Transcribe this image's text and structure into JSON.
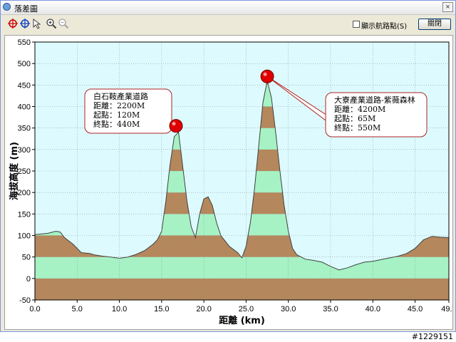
{
  "window": {
    "title": "落差圖",
    "close_glyph": "×"
  },
  "toolbar": {
    "tools": [
      {
        "name": "crosshair-red-icon",
        "color": "#cc0000"
      },
      {
        "name": "crosshair-blue-icon",
        "color": "#1040c0"
      },
      {
        "name": "select-arrow-icon",
        "color": "#404040"
      },
      {
        "name": "zoom-in-icon",
        "color": "#404040"
      },
      {
        "name": "zoom-out-icon",
        "color": "#a0a0a0"
      }
    ],
    "show_route_label": "顯示航路點(S)",
    "show_route_checked": false,
    "close_label": "關閉"
  },
  "chart_data": {
    "type": "area",
    "xlabel": "距離 (km)",
    "ylabel": "海拔高度 (m)",
    "xlim": [
      0,
      49.0
    ],
    "ylim": [
      -50,
      550
    ],
    "xticks": [
      "0.0",
      "5.0",
      "10.0",
      "15.0",
      "20.0",
      "25.0",
      "30.0",
      "35.0",
      "40.0",
      "45.0",
      "49.0"
    ],
    "yticks": [
      "-50",
      "0",
      "50",
      "100",
      "150",
      "200",
      "250",
      "300",
      "350",
      "400",
      "450",
      "500",
      "550"
    ],
    "grid": true,
    "band_step_m": 50,
    "colors": {
      "plot_background": "#ddfbff",
      "band_odd": "#b5875c",
      "band_even": "#a6f2c4",
      "outline": "#404040",
      "marker": "#e00000"
    },
    "profile": {
      "x": [
        0,
        1.5,
        2.5,
        3.0,
        3.5,
        4.5,
        5.5,
        6.5,
        7.0,
        8.0,
        9.0,
        10.0,
        11.0,
        12.0,
        13.0,
        14.0,
        14.5,
        15.0,
        15.5,
        16.0,
        16.5,
        17.0,
        17.5,
        18.0,
        18.5,
        19.0,
        19.5,
        20.0,
        20.5,
        21.0,
        21.5,
        22.0,
        23.0,
        24.0,
        24.5,
        25.0,
        25.5,
        26.0,
        26.5,
        27.0,
        27.5,
        28.0,
        28.5,
        29.0,
        29.5,
        30.0,
        30.5,
        31.0,
        32.0,
        33.0,
        34.0,
        35.0,
        36.0,
        37.0,
        38.0,
        39.0,
        40.0,
        41.0,
        42.0,
        43.0,
        44.0,
        45.0,
        46.0,
        47.0,
        48.0,
        49.0
      ],
      "y": [
        102,
        105,
        110,
        108,
        95,
        80,
        60,
        58,
        55,
        52,
        50,
        47,
        50,
        56,
        65,
        80,
        90,
        110,
        180,
        265,
        330,
        340,
        260,
        180,
        120,
        95,
        150,
        185,
        190,
        170,
        130,
        100,
        75,
        60,
        48,
        75,
        130,
        210,
        310,
        410,
        460,
        420,
        340,
        250,
        170,
        110,
        70,
        55,
        45,
        42,
        38,
        28,
        20,
        25,
        32,
        38,
        40,
        44,
        48,
        52,
        58,
        70,
        90,
        98,
        96,
        95
      ]
    },
    "peaks": [
      {
        "name": "白石鞍產業道路",
        "x": 16.7,
        "y": 355,
        "distance": "距離：2200M",
        "start": "起點：120M",
        "end": "終點：440M"
      },
      {
        "name": "大寮產業道路-紫薇森林",
        "x": 27.5,
        "y": 470,
        "distance": "距離：4200M",
        "start": "起點：65M",
        "end": "終點：550M"
      }
    ]
  },
  "footer": {
    "watermark": "#1229151"
  }
}
